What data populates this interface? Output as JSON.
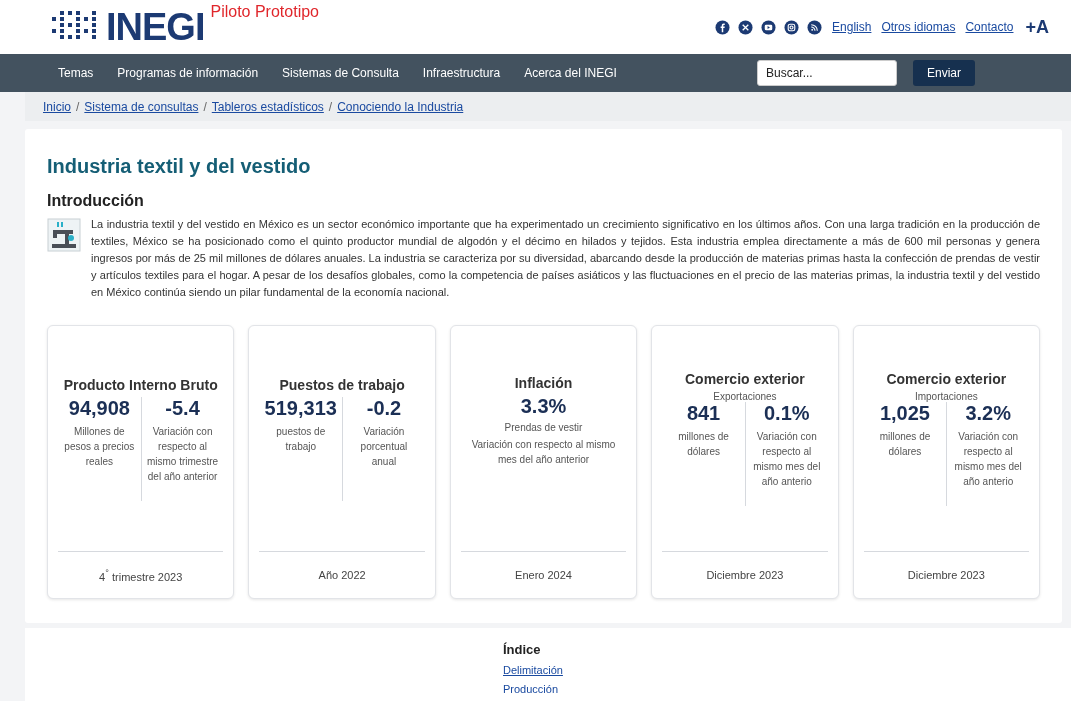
{
  "header": {
    "logo": "INEGI",
    "tagline": "Piloto Prototipo",
    "links": [
      "English",
      "Otros idiomas",
      "Contacto"
    ],
    "font_size_button": "+A"
  },
  "nav": {
    "items": [
      "Temas",
      "Programas de información",
      "Sistemas de Consulta",
      "Infraestructura",
      "Acerca del INEGI"
    ],
    "search": {
      "placeholder": "Buscar..."
    },
    "submit": "Enviar"
  },
  "breadcrumb": {
    "separator": "/",
    "items": [
      "Inicio",
      "Sistema de consultas",
      "Tableros estadísticos",
      "Conociendo la Industria"
    ]
  },
  "title": "Industria textil y del vestido",
  "intro": {
    "heading": "Introducción",
    "text": "La industria textil y del vestido en México es un sector económico importante que ha experimentado un crecimiento significativo en los últimos años. Con una larga tradición en la producción de textiles, México se ha posicionado como el quinto productor mundial de algodón y el décimo en hilados y tejidos. Esta industria emplea directamente a más de 600 mil personas y genera ingresos por más de 25 mil millones de dólares anuales. La industria se caracteriza por su diversidad, abarcando desde la producción de materias primas hasta la confección de prendas de vestir y artículos textiles para el hogar. A pesar de los desafíos globales, como la competencia de países asiáticos y las fluctuaciones en el precio de las materias primas, la industria textil y del vestido en México continúa siendo un pilar fundamental de la economía nacional."
  },
  "cards": [
    {
      "kind": "split",
      "title": "Producto Interno Bruto",
      "metrics": [
        {
          "value": "94,908",
          "caption": "Millones de pesos a precios reales"
        },
        {
          "value": "-5.4",
          "caption": "Variación con respecto al mismo trimestre del año anterior"
        }
      ],
      "period": "4$^{°}$ trimestre 2023"
    },
    {
      "kind": "split",
      "title": "Puestos de trabajo",
      "metrics": [
        {
          "value": "519,313",
          "caption": "puestos de trabajo"
        },
        {
          "value": "-0.2",
          "caption": "Variación porcentual anual"
        }
      ],
      "period": "Año 2022"
    },
    {
      "kind": "single",
      "title": "Inflación",
      "value": "3.3%",
      "captions": [
        "Prendas de vestir",
        "Variación con respecto al mismo mes del año anterior"
      ],
      "period": "Enero 2024"
    },
    {
      "kind": "split",
      "title": "Comercio exterior",
      "subtitle": "Exportaciones",
      "metrics": [
        {
          "value": "841",
          "caption": "millones de dólares"
        },
        {
          "value": "0.1%",
          "caption": "Variación con respecto al mismo mes del año anterio"
        }
      ],
      "period": "Diciembre 2023"
    },
    {
      "kind": "split",
      "title": "Comercio exterior",
      "subtitle": "Importaciones",
      "metrics": [
        {
          "value": "1,025",
          "caption": "millones de dólares"
        },
        {
          "value": "3.2%",
          "caption": "Variación con respecto al mismo mes del año anterio"
        }
      ],
      "period": "Diciembre 2023"
    }
  ],
  "index": {
    "heading": "Índice",
    "links": [
      "Delimitación",
      "Producción"
    ]
  }
}
